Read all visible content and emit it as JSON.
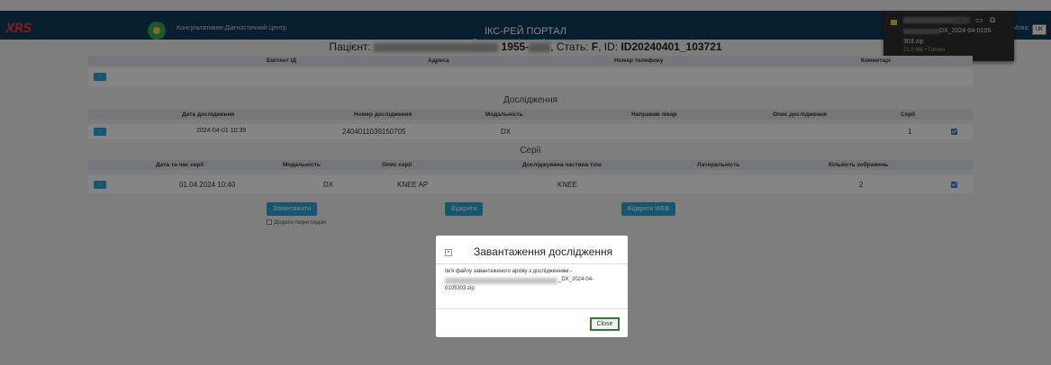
{
  "header": {
    "logo_text": "XRS",
    "center_name": "Консультативно-Діагностичний Центр",
    "title": "ІКС-РЕЙ ПОРТАЛ",
    "subtitle": "Радіологічна інформаційна система",
    "lang_label": "Мова:",
    "lang_value": "UK"
  },
  "download": {
    "file_name_suffix": "DX_2024-04-0105",
    "file_name_line2": "303.zip",
    "status": "21,0 МБ • Готово",
    "folder_icon": "folder-icon",
    "open_icon": "external-link-icon"
  },
  "patient": {
    "label": "Пацієнт:",
    "year_prefix": "1955-",
    "sex_label": ", Стать:",
    "sex": "F",
    "id_label": ", ID:",
    "id": "ID20240401_103721"
  },
  "patient_table": {
    "headers": [
      "Емітент ІД",
      "Адреса",
      "Номер телефону",
      "Коментарі"
    ],
    "button": "···"
  },
  "studies": {
    "title": "Дослідження",
    "headers": [
      "Дата дослідження",
      "Номер дослідження",
      "Модальність",
      "Направив лікар",
      "Опис дослідження",
      "Серії"
    ],
    "rows": [
      {
        "date": "2024-04-01 10:39",
        "number": "2404011039150705",
        "modality": "DX",
        "doctor": "",
        "description": "",
        "series": "1"
      }
    ]
  },
  "series": {
    "title": "Серії",
    "headers": [
      "Дата та час серії",
      "Модальність",
      "Опис серії",
      "Досліджувана частина тіла",
      "Латеральність",
      "Кількість зображень"
    ],
    "rows": [
      {
        "datetime": "01.04.2024 10:40",
        "modality": "DX",
        "description": "KNEE AP",
        "body_part": "KNEE",
        "laterality": "",
        "images": "2"
      }
    ]
  },
  "actions": {
    "download": "Завантажити",
    "open": "Відкрити",
    "open_web": "Відкрити WEB",
    "add_viewer": "Додати переглядач"
  },
  "modal": {
    "close_x": "×",
    "title": "Завантаження дослідження",
    "body_line1": "Ім'я файлу завантаженого архіву з дослідженням -",
    "body_line2_suffix": "_DX_2024-04-",
    "body_line3": "0105303.zip",
    "close_button": "Close"
  },
  "colors": {
    "header_bg": "#0f3b5a",
    "accent": "#26a9d6",
    "checkbox": "#2d7fe0",
    "close_outline": "#2e7d32"
  }
}
